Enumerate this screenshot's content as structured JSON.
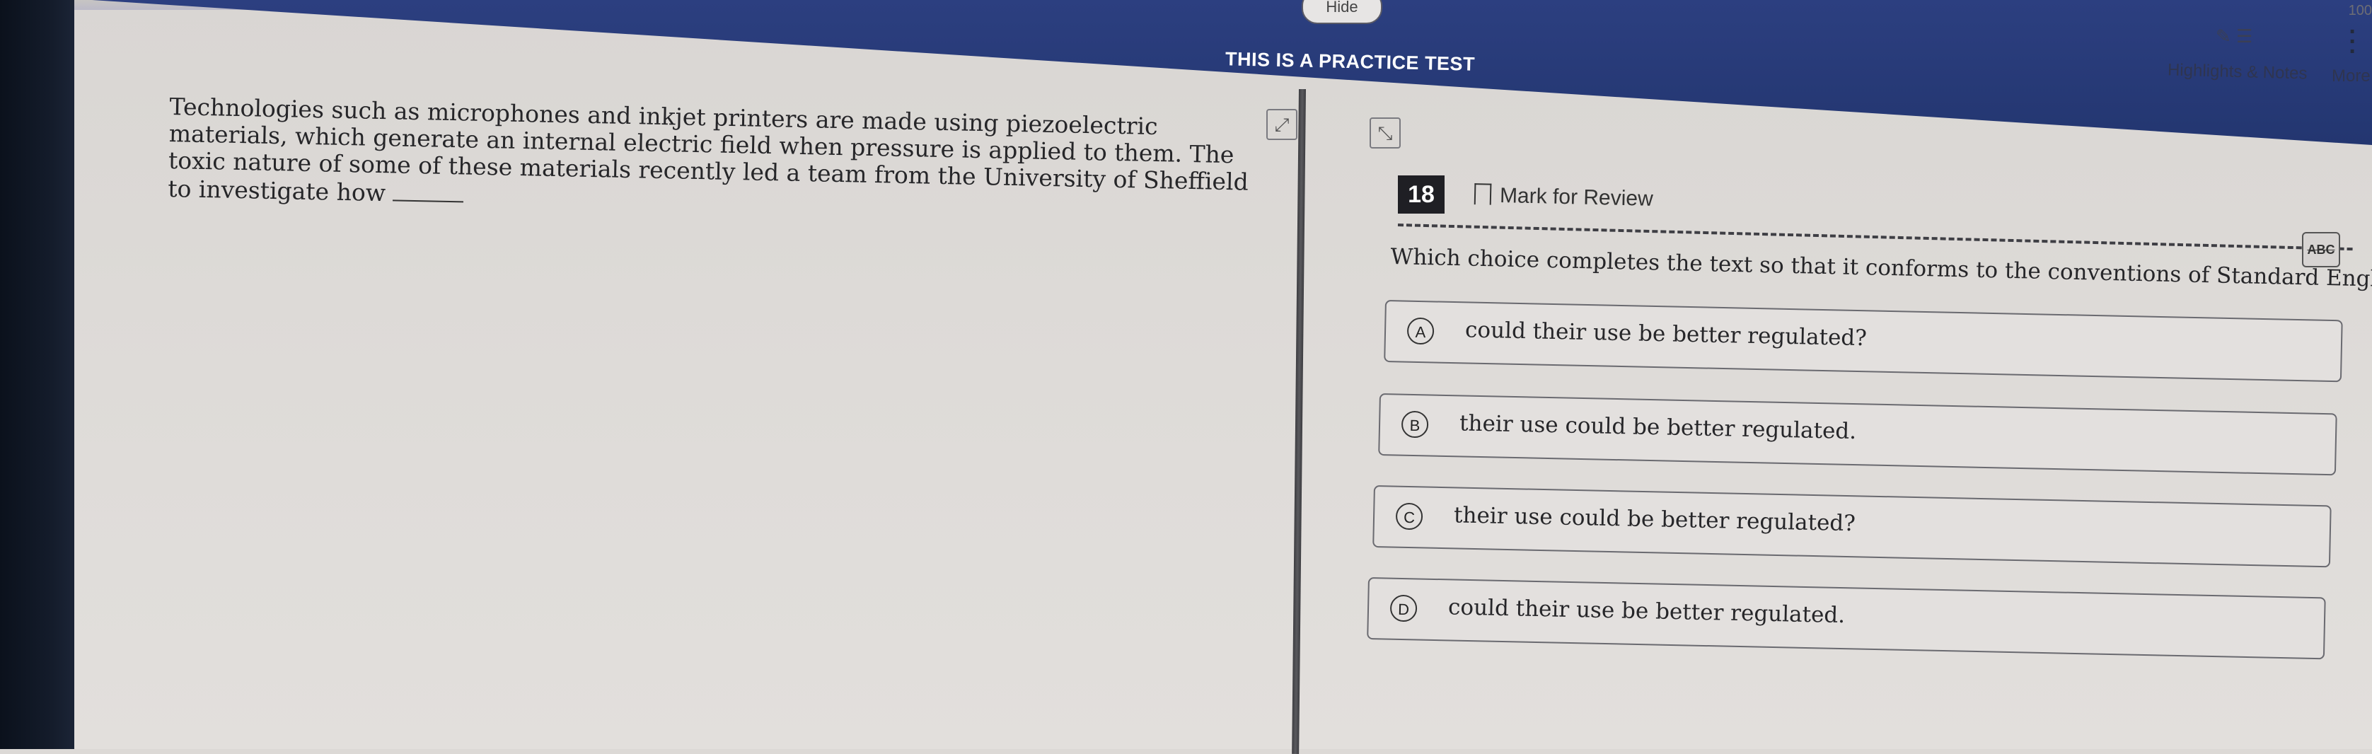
{
  "header": {
    "hide_label": "Hide",
    "banner_text": "THIS IS A PRACTICE TEST",
    "counter": "100",
    "tools_label": "Highlights & Notes",
    "more_label": "More"
  },
  "passage": {
    "text": "Technologies such as microphones and inkjet printers are made using piezoelectric materials, which generate an internal electric field when pressure is applied to them. The toxic nature of some of these materials recently led a team from the University of Sheffield to investigate how"
  },
  "question": {
    "number": "18",
    "mark_label": "Mark for Review",
    "abc_label": "ABC",
    "prompt": "Which choice completes the text so that it conforms to the conventions of Standard English?",
    "options": [
      {
        "letter": "A",
        "text": "could their use be better regulated?"
      },
      {
        "letter": "B",
        "text": "their use could be better regulated."
      },
      {
        "letter": "C",
        "text": "their use could be better regulated?"
      },
      {
        "letter": "D",
        "text": "could their use be better regulated."
      }
    ]
  },
  "icons": {
    "highlight": "pen-icon",
    "notes": "note-icon",
    "more": "vertical-dots-icon",
    "expand_left": "expand-icon",
    "expand_right": "collapse-icon",
    "bookmark": "bookmark-icon"
  },
  "colors": {
    "banner": "#2c3f80",
    "bezel": "#141c2b",
    "number_box": "#1f1f24"
  }
}
